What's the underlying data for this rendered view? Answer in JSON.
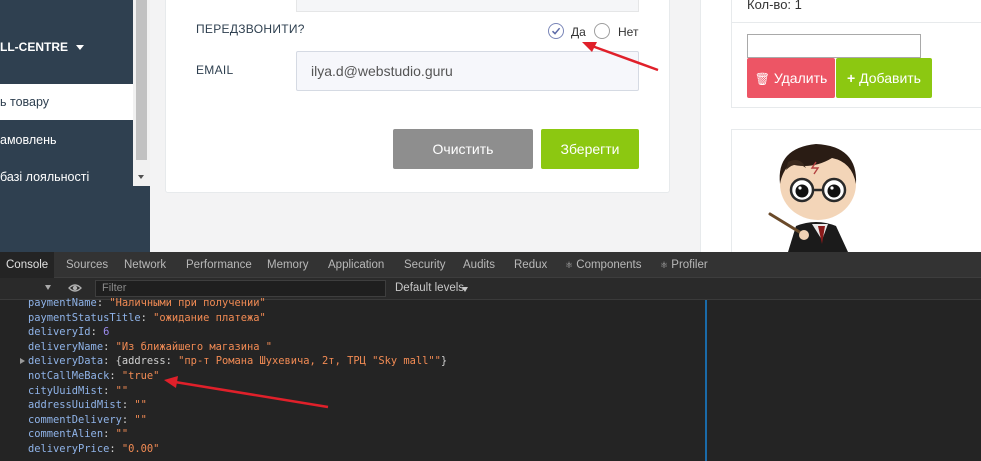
{
  "sidebar": {
    "brand": "LL-CENTRE",
    "items": [
      {
        "label": "ь товару",
        "active": true
      },
      {
        "label": "амовлень",
        "active": false
      },
      {
        "label": " базі лояльності",
        "active": false
      }
    ]
  },
  "form": {
    "callback_label": "ПЕРЕДЗВОНИТИ?",
    "yes_label": "Да",
    "no_label": "Нет",
    "email_label": "EMAIL",
    "email_value": "ilya.d@webstudio.guru",
    "clear_label": "Очистить",
    "save_label": "Зберегти"
  },
  "right": {
    "qty_label": "Кол-во: 1",
    "delete_label": "Удалить",
    "add_label": "Добавить"
  },
  "devtools": {
    "tabs": [
      "Console",
      "Sources",
      "Network",
      "Performance",
      "Memory",
      "Application",
      "Security",
      "Audits",
      "Redux",
      "Components",
      "Profiler"
    ],
    "filter_placeholder": "Filter",
    "levels_label": "Default levels"
  },
  "console": {
    "lines": [
      {
        "key": "paymentName",
        "value": "\"Наличными при получении\"",
        "type": "string"
      },
      {
        "key": "paymentStatusTitle",
        "value": "\"ожидание платежа\"",
        "type": "string"
      },
      {
        "key": "deliveryId",
        "value": "6",
        "type": "number"
      },
      {
        "key": "deliveryName",
        "value": "\"Из ближайшего магазина \"",
        "type": "string"
      },
      {
        "key": "deliveryData",
        "value": "\"пр-т Романа Шухевича, 2т, ТРЦ \"Sky mall\"\"",
        "type": "object",
        "inner_key": "address"
      },
      {
        "key": "notCallMeBack",
        "value": "\"true\"",
        "type": "string"
      },
      {
        "key": "cityUuidMist",
        "value": "\"\"",
        "type": "string"
      },
      {
        "key": "addressUuidMist",
        "value": "\"\"",
        "type": "string"
      },
      {
        "key": "commentDelivery",
        "value": "\"\"",
        "type": "string"
      },
      {
        "key": "commentAlien",
        "value": "\"\"",
        "type": "string"
      },
      {
        "key": "deliveryPrice",
        "value": "\"0.00\"",
        "type": "string"
      }
    ]
  },
  "colors": {
    "sidebar_bg": "#2f4050",
    "green": "#8cc811",
    "gray_button": "#8e8e8e",
    "red": "#ed5565",
    "annotation_arrow": "#e0202a"
  }
}
